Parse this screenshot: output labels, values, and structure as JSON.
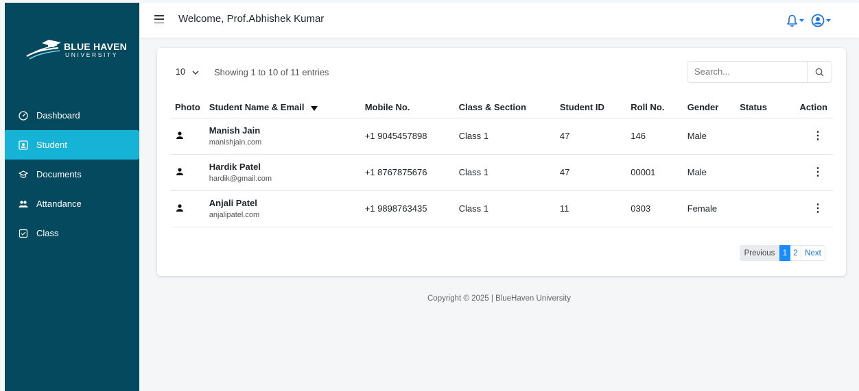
{
  "brand": {
    "name": "BLUE HAVEN",
    "subtitle": "UNIVERSITY",
    "sidebar_color": "#05495f",
    "active_color": "#17b3d6"
  },
  "sidebar": {
    "items": [
      {
        "label": "Dashboard",
        "icon": "gauge-icon",
        "active": false
      },
      {
        "label": "Student",
        "icon": "student-card-icon",
        "active": true
      },
      {
        "label": "Documents",
        "icon": "graduation-cap-icon",
        "active": false
      },
      {
        "label": "Attandance",
        "icon": "users-icon",
        "active": false
      },
      {
        "label": "Class",
        "icon": "checklist-icon",
        "active": false
      }
    ]
  },
  "header": {
    "welcome": "Welcome, Prof.Abhishek Kumar",
    "icons": [
      "menu-icon",
      "bell-icon",
      "user-circle-icon"
    ]
  },
  "table_controls": {
    "page_length": "10",
    "info": "Showing 1 to 10 of 11 entries",
    "search_placeholder": "Search..."
  },
  "table": {
    "columns": [
      "Photo",
      "Student Name & Email",
      "Mobile No.",
      "Class & Section",
      "Student ID",
      "Roll No.",
      "Gender",
      "Status",
      "Action"
    ],
    "rows": [
      {
        "name": "Manish Jain",
        "email": "manishjain.com",
        "mobile": "+1 9045457898",
        "class": "Class 1",
        "student_id": "47",
        "roll": "146",
        "gender": "Male",
        "status": ""
      },
      {
        "name": "Hardik Patel",
        "email": "hardik@gmail.com",
        "mobile": "+1 8767875676",
        "class": "Class 1",
        "student_id": "47",
        "roll": "00001",
        "gender": "Male",
        "status": ""
      },
      {
        "name": "Anjali Patel",
        "email": "anjalipatel.com",
        "mobile": "+1 9898763435",
        "class": "Class 1",
        "student_id": "11",
        "roll": "0303",
        "gender": "Female",
        "status": ""
      }
    ]
  },
  "pagination": {
    "previous": "Previous",
    "pages": [
      "1",
      "2"
    ],
    "current": "1",
    "next": "Next"
  },
  "footer": {
    "text": "Copyright © 2025 | BlueHaven University"
  }
}
